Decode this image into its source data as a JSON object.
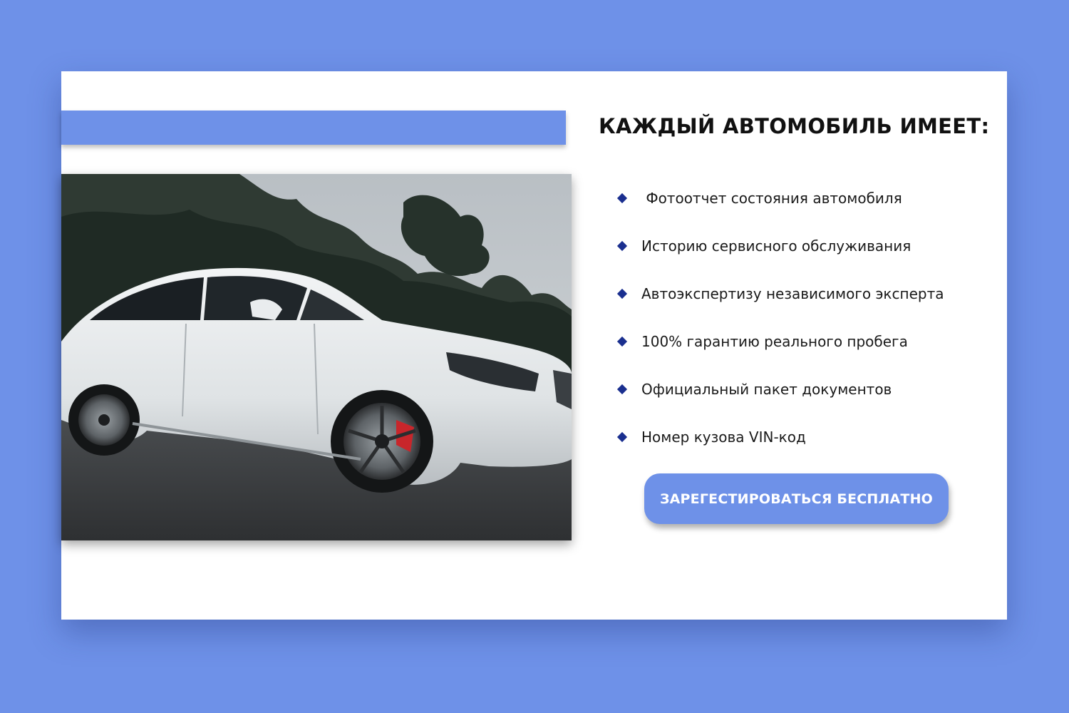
{
  "colors": {
    "background": "#6e91e8",
    "card": "#ffffff",
    "accent": "#6e91e8",
    "bullet": "#1a2f8f",
    "button_text": "#ffffff"
  },
  "photo": {
    "subject": "white-station-wagon-car-photo"
  },
  "heading": "КАЖДЫЙ АВТОМОБИЛЬ ИМЕЕТ:",
  "features": [
    {
      "label": " Фотоотчет состояния автомобиля",
      "icon": "diamond-bullet-icon"
    },
    {
      "label": "Историю сервисного обслуживания",
      "icon": "diamond-bullet-icon"
    },
    {
      "label": "Автоэкспертизу независимого эксперта",
      "icon": "diamond-bullet-icon"
    },
    {
      "label": "100% гарантию реального пробега",
      "icon": "diamond-bullet-icon"
    },
    {
      "label": "Официальный пакет документов",
      "icon": "diamond-bullet-icon"
    },
    {
      "label": "Номер кузова VIN-код",
      "icon": "diamond-bullet-icon"
    }
  ],
  "cta": {
    "label": "ЗАРЕГЕСТИРОВАТЬСЯ БЕСПЛАТНО"
  }
}
